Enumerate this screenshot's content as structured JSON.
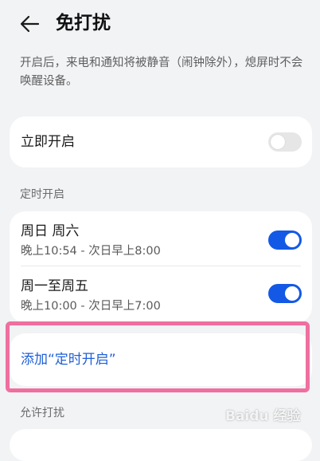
{
  "header": {
    "title": "免打扰",
    "back_icon": "arrow-left-icon"
  },
  "description": "开启后，来电和通知将被静音（闹钟除外），熄屏时不会唤醒设备。",
  "start_now": {
    "label": "立即开启",
    "enabled": false
  },
  "scheduled": {
    "section_title": "定时开启",
    "items": [
      {
        "days": "周日 周六",
        "time": "晚上10:54 - 次日早上8:00",
        "enabled": true
      },
      {
        "days": "周一至周五",
        "time": "晚上10:00 - 次日早上7:00",
        "enabled": true
      }
    ],
    "add_label": "添加“定时开启”"
  },
  "allow": {
    "section_title": "允许打扰"
  },
  "watermark": "Baidu 经验",
  "colors": {
    "accent": "#1459e6",
    "link": "#1f5fd9",
    "highlight": "#ef6f9f",
    "background": "#f1f3f5"
  }
}
